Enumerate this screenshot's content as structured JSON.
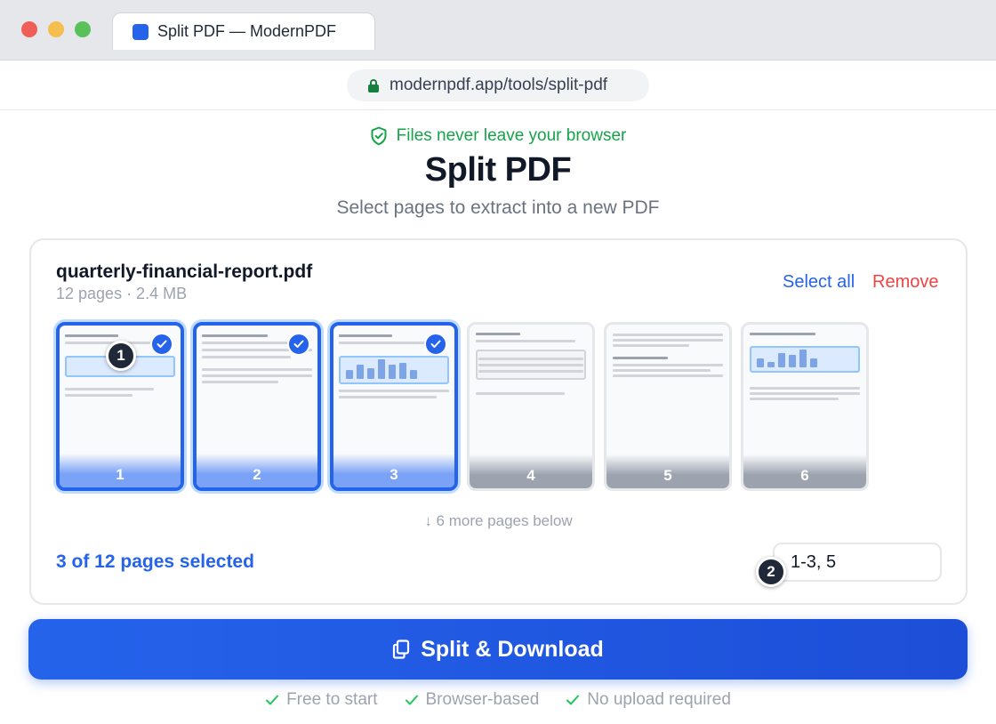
{
  "browser": {
    "tab_title": "Split PDF — ModernPDF",
    "url": "modernpdf.app/tools/split-pdf"
  },
  "header": {
    "privacy_note": "Files never leave your browser",
    "title": "Split PDF",
    "subtitle": "Select pages to extract into a new PDF"
  },
  "file": {
    "name": "quarterly-financial-report.pdf",
    "meta": "12 pages · 2.4 MB",
    "select_all_label": "Select all",
    "remove_label": "Remove"
  },
  "pages": [
    {
      "number": "1",
      "selected": true
    },
    {
      "number": "2",
      "selected": true
    },
    {
      "number": "3",
      "selected": true
    },
    {
      "number": "4",
      "selected": false
    },
    {
      "number": "5",
      "selected": false
    },
    {
      "number": "6",
      "selected": false
    }
  ],
  "badges": {
    "first": "1",
    "second": "2"
  },
  "more_pages": "↓ 6 more pages below",
  "selection": {
    "count_text": "3 of 12 pages selected",
    "range_value": "1-3, 5"
  },
  "cta": {
    "label": "Split & Download"
  },
  "features": [
    "Free to start",
    "Browser-based",
    "No upload required"
  ],
  "colors": {
    "accent": "#2563eb",
    "success": "#16a34a",
    "danger": "#ef4444"
  }
}
